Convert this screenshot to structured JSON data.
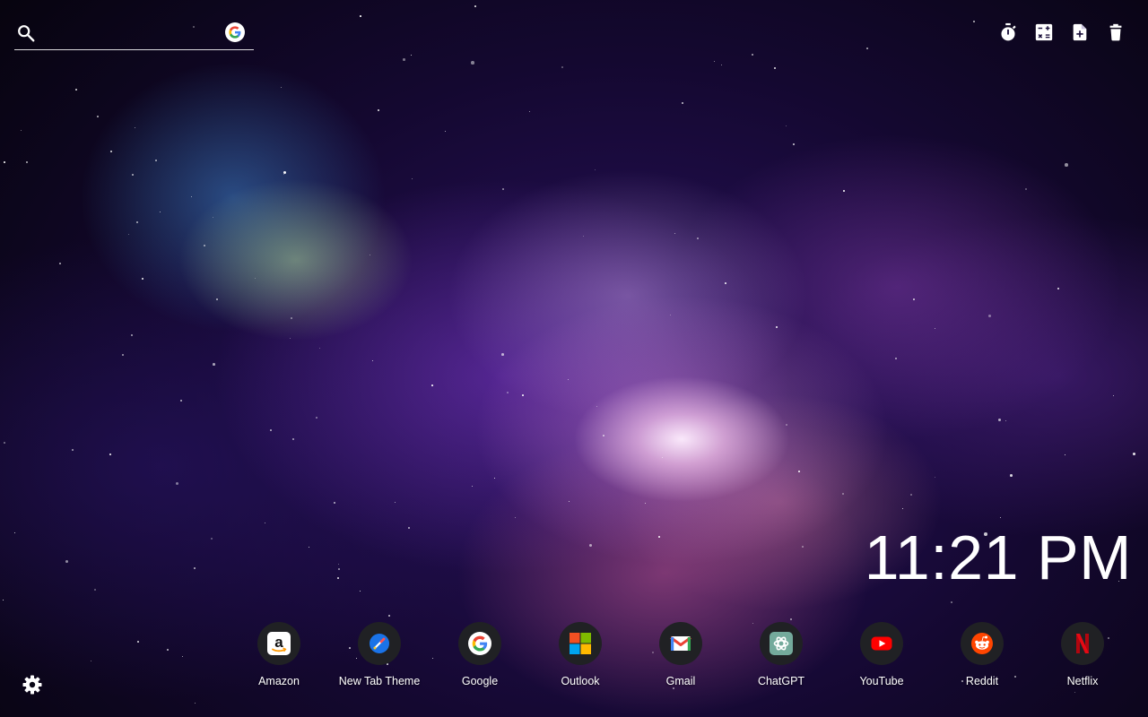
{
  "search": {
    "value": "",
    "placeholder": "",
    "engine_icon": "google-g-icon"
  },
  "toolbar": [
    {
      "icon": "timer-icon"
    },
    {
      "icon": "calculator-icon"
    },
    {
      "icon": "new-note-icon"
    },
    {
      "icon": "trash-icon"
    }
  ],
  "clock": {
    "time": "11:21 PM"
  },
  "shortcuts": [
    {
      "label": "Amazon",
      "icon": "amazon-icon"
    },
    {
      "label": "New Tab Theme",
      "icon": "new-tab-theme-icon"
    },
    {
      "label": "Google",
      "icon": "google-icon"
    },
    {
      "label": "Outlook",
      "icon": "outlook-icon"
    },
    {
      "label": "Gmail",
      "icon": "gmail-icon"
    },
    {
      "label": "ChatGPT",
      "icon": "chatgpt-icon"
    },
    {
      "label": "YouTube",
      "icon": "youtube-icon"
    },
    {
      "label": "Reddit",
      "icon": "reddit-icon"
    },
    {
      "label": "Netflix",
      "icon": "netflix-icon"
    }
  ],
  "settings": {
    "icon": "gear-icon"
  },
  "colors": {
    "text": "#ffffff",
    "tile_background": "#202124",
    "youtube_red": "#ff0000",
    "reddit_orange": "#ff4500",
    "netflix_red": "#e50914"
  }
}
